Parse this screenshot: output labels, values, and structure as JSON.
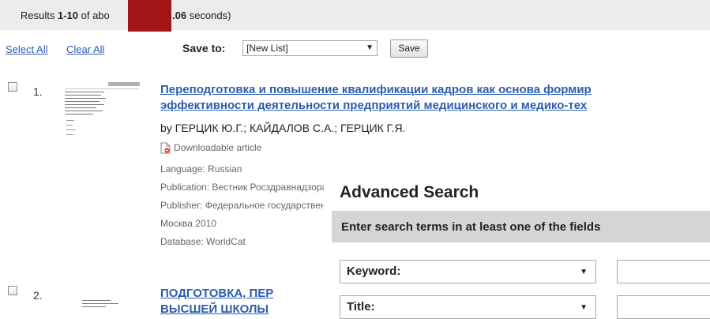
{
  "results": {
    "prefix": "Results ",
    "range": "1-10",
    "mid": " of abo",
    "time": ".06",
    "suffix": " seconds)"
  },
  "toolbar": {
    "select_all": "Select All",
    "clear_all": "Clear All",
    "save_to_label": "Save to:",
    "save_list_value": "[New List]",
    "save_button": "Save"
  },
  "items": [
    {
      "num": "1.",
      "title_line1": "Переподготовка и повышение квалификации кадров как основа формир",
      "title_line2": "эффективности деятельности предприятий медицинского и медико-тех",
      "by": "by ГЕРЦИК Ю.Г.; КАЙДАЛОВ С.А.; ГЕРЦИК Г.Я.",
      "download": "Downloadable article",
      "language": "Language: Russian",
      "publication": "Publication: Вестник Росздравнадзора",
      "publisher": "Publisher: Федеральное государственное",
      "place_year": "Москва 2010",
      "database": "Database: WorldCat"
    },
    {
      "num": "2.",
      "title_line1": "ПОДГОТОВКА, ПЕР",
      "title_line2": "ВЫСШЕЙ ШКОЛЫ"
    }
  ],
  "advanced_search": {
    "title": "Advanced Search",
    "instruction": "Enter search terms in at least one of the fields",
    "fields": [
      {
        "label": "Keyword:"
      },
      {
        "label": "Title:"
      }
    ]
  }
}
